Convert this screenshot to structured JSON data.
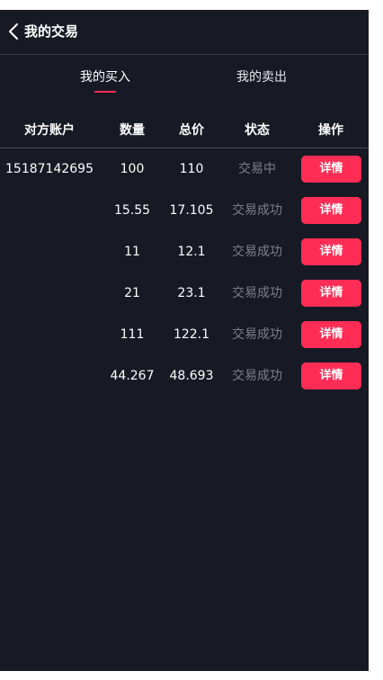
{
  "header": {
    "title": "我的交易",
    "back_icon": "chevron-left-icon"
  },
  "tabs": [
    {
      "label": "我的买入",
      "active": true
    },
    {
      "label": "我的卖出",
      "active": false
    }
  ],
  "colors": {
    "background": "#171924",
    "accent": "#ff2d55",
    "status_gray": "#7d7f8a"
  },
  "table": {
    "columns": [
      "对方账户",
      "数量",
      "总价",
      "状态",
      "操作"
    ],
    "rows": [
      {
        "account": "15187142695",
        "qty": "100",
        "total": "110",
        "status": "交易中",
        "action": "详情"
      },
      {
        "account": "",
        "qty": "15.55",
        "total": "17.105",
        "status": "交易成功",
        "action": "详情"
      },
      {
        "account": "",
        "qty": "11",
        "total": "12.1",
        "status": "交易成功",
        "action": "详情"
      },
      {
        "account": "",
        "qty": "21",
        "total": "23.1",
        "status": "交易成功",
        "action": "详情"
      },
      {
        "account": "",
        "qty": "111",
        "total": "122.1",
        "status": "交易成功",
        "action": "详情"
      },
      {
        "account": "",
        "qty": "44.267",
        "total": "48.693",
        "status": "交易成功",
        "action": "详情"
      }
    ]
  }
}
